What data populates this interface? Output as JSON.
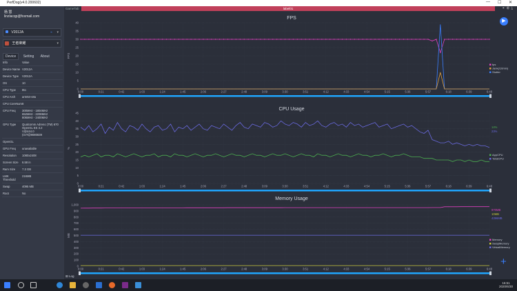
{
  "window": {
    "title": "PerfDog(v4.0.200602)"
  },
  "user": {
    "name": "杨 慧",
    "email": "linzlacqp@foxmail.com"
  },
  "device": {
    "selected": "V2012A"
  },
  "app": {
    "selected": "王者荣耀"
  },
  "sidebar_tabs": [
    {
      "label": "Device"
    },
    {
      "label": "Setting"
    },
    {
      "label": "About"
    }
  ],
  "info_table": {
    "headers": [
      "Info",
      "Value"
    ],
    "rows": [
      {
        "k": "Device Name",
        "v": "V2012A"
      },
      {
        "k": "Device Type",
        "v": "V2012A"
      },
      {
        "k": "OS",
        "v": "10"
      },
      {
        "k": "CPU Type",
        "v": "8to"
      },
      {
        "k": "CPU Arch",
        "v": "arm64-v8a"
      },
      {
        "k": "CPU CoreNum",
        "v": "8"
      },
      {
        "k": "CPU Freq",
        "v": "300MHz - 1804MHz\n652MHz - 2208MHz\n806MHz - 2400MHz"
      },
      {
        "k": "GPU Type",
        "v": "Qualcomm Adreno (TM) 670\nOpenGL ES 3.2\nV@444.0\n(GIT@9080839"
      },
      {
        "k": "OpenGL",
        "v": ""
      },
      {
        "k": "GPU Freq",
        "v": "unavailable"
      },
      {
        "k": "Resolution",
        "v": "1080x2408"
      },
      {
        "k": "Screen Size",
        "v": "6.58 in"
      },
      {
        "k": "Ram Size",
        "v": "7.3 GB"
      },
      {
        "k": "LMK Threshold",
        "v": "216MB"
      },
      {
        "k": "Swap",
        "v": "4095 MB"
      },
      {
        "k": "Root",
        "v": "No"
      }
    ]
  },
  "main_tabs": {
    "game": "GameTab",
    "label": "label01"
  },
  "time_ticks": [
    "0:00",
    "0:21",
    "0:42",
    "1:03",
    "1:24",
    "1:45",
    "2:06",
    "2:27",
    "2:48",
    "3:09",
    "3:30",
    "3:51",
    "4:12",
    "4:33",
    "4:54",
    "5:15",
    "5:36",
    "5:57",
    "6:18",
    "6:39",
    "6:48"
  ],
  "chart_data": [
    {
      "type": "line",
      "title": "FPS",
      "ylabel": "FPS",
      "ylim": [
        0,
        40
      ],
      "yticks": [
        0,
        5,
        10,
        15,
        20,
        25,
        30,
        35,
        40
      ],
      "legend": [
        {
          "name": "fps",
          "color": "#e040c0"
        },
        {
          "name": "Jank(/10min)",
          "color": "#e0a040"
        },
        {
          "name": "Stutter",
          "color": "#3a7fff"
        }
      ],
      "series": [
        {
          "name": "fps",
          "color": "#e040c0",
          "values": [
            30,
            30,
            30,
            30,
            30,
            30,
            30,
            30,
            30,
            30,
            30,
            30,
            30,
            30,
            30,
            30,
            30,
            30,
            30,
            30,
            30,
            30,
            30,
            30,
            30,
            30,
            30,
            30,
            30,
            30,
            30,
            30,
            30,
            30,
            30,
            30,
            30,
            30,
            30,
            30,
            30,
            30,
            30,
            30,
            30,
            30,
            30,
            30,
            30,
            30,
            30,
            30,
            30,
            30,
            30,
            30,
            30,
            30,
            30,
            30,
            30,
            30,
            30,
            30,
            30,
            30,
            30,
            30,
            30,
            30,
            30,
            30,
            30,
            30,
            30,
            30,
            30,
            30,
            30,
            30,
            30,
            30,
            30,
            30,
            30,
            30,
            29,
            30,
            22,
            30,
            30,
            30,
            30,
            30,
            30,
            30,
            30,
            30,
            30,
            30,
            30
          ]
        },
        {
          "name": "Stutter",
          "color": "#3a7fff",
          "values": [
            0,
            0,
            0,
            0,
            0,
            0,
            0,
            0,
            0,
            0,
            0,
            0,
            0,
            0,
            0,
            0,
            0,
            0,
            0,
            0,
            0,
            0,
            0,
            0,
            0,
            0,
            0,
            0,
            0,
            0,
            0,
            0,
            0,
            0,
            0,
            0,
            0,
            0,
            0,
            0,
            0,
            0,
            0,
            0,
            0,
            0,
            0,
            0,
            0,
            0,
            0,
            0,
            0,
            0,
            0,
            0,
            0,
            0,
            0,
            0,
            0,
            0,
            0,
            0,
            0,
            0,
            0,
            0,
            0,
            0,
            0,
            0,
            0,
            0,
            0,
            0,
            0,
            0,
            0,
            0,
            0,
            0,
            0,
            0,
            0,
            0,
            0,
            0,
            39,
            0,
            0,
            0,
            0,
            0,
            0,
            0,
            0,
            0,
            0,
            0,
            0
          ]
        },
        {
          "name": "Jank(/10min)",
          "color": "#e0a040",
          "values": [
            0,
            0,
            0,
            0,
            0,
            0,
            0,
            0,
            0,
            0,
            0,
            0,
            0,
            0,
            0,
            0,
            0,
            0,
            0,
            0,
            0,
            0,
            0,
            0,
            0,
            0,
            0,
            0,
            0,
            0,
            0,
            0,
            0,
            0,
            0,
            0,
            0,
            0,
            0,
            0,
            0,
            0,
            0,
            0,
            0,
            0,
            0,
            0,
            0,
            0,
            0,
            0,
            0,
            0,
            0,
            0,
            0,
            0,
            0,
            0,
            0,
            0,
            0,
            0,
            0,
            0,
            0,
            0,
            0,
            0,
            0,
            0,
            0,
            0,
            0,
            0,
            0,
            0,
            0,
            0,
            0,
            0,
            0,
            0,
            0,
            0,
            0,
            0,
            10,
            0,
            0,
            0,
            0,
            0,
            0,
            0,
            0,
            0,
            0,
            0,
            0
          ]
        }
      ]
    },
    {
      "type": "line",
      "title": "CPU Usage",
      "ylabel": "%",
      "ylim": [
        0,
        45
      ],
      "yticks": [
        0,
        5,
        10,
        15,
        20,
        25,
        30,
        35,
        40,
        45
      ],
      "legend": [
        {
          "name": "AppCPU",
          "color": "#4caf50"
        },
        {
          "name": "TotalCPU",
          "color": "#6a6ae0"
        }
      ],
      "current": [
        {
          "value": "14%",
          "color": "#4caf50"
        },
        {
          "value": "23%",
          "color": "#6a6ae0"
        }
      ],
      "series": [
        {
          "name": "TotalCPU",
          "color": "#6a6ae0",
          "values": [
            36,
            34,
            37,
            33,
            35,
            38,
            32,
            36,
            34,
            39,
            35,
            33,
            37,
            36,
            34,
            38,
            35,
            33,
            36,
            37,
            34,
            35,
            38,
            33,
            36,
            35,
            37,
            34,
            36,
            38,
            35,
            34,
            37,
            36,
            35,
            38,
            36,
            34,
            37,
            39,
            36,
            35,
            38,
            37,
            36,
            39,
            38,
            36,
            37,
            40,
            38,
            37,
            39,
            38,
            36,
            39,
            37,
            38,
            40,
            37,
            36,
            38,
            39,
            37,
            38,
            36,
            39,
            37,
            38,
            36,
            37,
            38,
            39,
            36,
            37,
            38,
            35,
            36,
            37,
            38,
            36,
            37,
            35,
            33,
            32,
            34,
            28,
            27,
            26,
            26,
            27,
            25,
            26,
            25,
            24,
            25,
            24,
            25,
            24,
            24,
            23
          ]
        },
        {
          "name": "AppCPU",
          "color": "#4caf50",
          "values": [
            17,
            18,
            17,
            18,
            19,
            17,
            18,
            18,
            17,
            19,
            18,
            17,
            18,
            19,
            18,
            17,
            18,
            18,
            19,
            17,
            18,
            18,
            17,
            19,
            18,
            18,
            17,
            18,
            19,
            18,
            17,
            18,
            18,
            19,
            18,
            17,
            18,
            19,
            18,
            18,
            17,
            18,
            19,
            18,
            18,
            17,
            18,
            19,
            18,
            18,
            19,
            18,
            17,
            18,
            19,
            18,
            18,
            17,
            19,
            18,
            18,
            17,
            18,
            19,
            18,
            18,
            17,
            18,
            19,
            18,
            18,
            17,
            18,
            18,
            19,
            18,
            17,
            18,
            18,
            19,
            18,
            17,
            17,
            17,
            16,
            16,
            16,
            15,
            15,
            15,
            15,
            14,
            15,
            15,
            14,
            15,
            14,
            14,
            15,
            14,
            14
          ]
        }
      ]
    },
    {
      "type": "line",
      "title": "Memory Usage",
      "ylabel": "MB",
      "ylim": [
        0,
        1000
      ],
      "yticks": [
        0,
        100,
        200,
        300,
        400,
        500,
        600,
        700,
        800,
        900,
        1000
      ],
      "legend": [
        {
          "name": "Memory",
          "color": "#e040c0"
        },
        {
          "name": "SwapMemory",
          "color": "#c6c63a"
        },
        {
          "name": "VirtualMemory",
          "color": "#6a6ae0"
        }
      ],
      "current": [
        {
          "value": "970MB",
          "color": "#e040c0"
        },
        {
          "value": "10MB",
          "color": "#c6c63a"
        },
        {
          "value": "4396MB",
          "color": "#6a6ae0"
        }
      ],
      "series": [
        {
          "name": "Memory",
          "color": "#e040c0",
          "values": [
            945,
            946,
            946,
            947,
            947,
            947,
            948,
            948,
            948,
            949,
            949,
            949,
            950,
            950,
            950,
            950,
            950,
            950,
            950,
            951,
            951,
            951,
            951,
            951,
            951,
            951,
            952,
            952,
            952,
            952,
            952,
            952,
            952,
            952,
            952,
            952,
            953,
            953,
            953,
            953,
            953,
            953,
            953,
            953,
            953,
            953,
            953,
            953,
            953,
            953,
            954,
            954,
            954,
            954,
            954,
            954,
            954,
            954,
            954,
            954,
            954,
            954,
            954,
            954,
            954,
            954,
            954,
            954,
            954,
            954,
            954,
            954,
            954,
            954,
            954,
            954,
            954,
            954,
            954,
            954,
            954,
            954,
            954,
            954,
            954,
            954,
            955,
            955,
            955,
            968,
            969,
            969,
            969,
            970,
            970,
            970,
            970,
            970,
            970,
            970,
            970
          ]
        },
        {
          "name": "VirtualMemory",
          "color": "#6a6ae0",
          "values": [
            505,
            505,
            505,
            505,
            505,
            505,
            505,
            505,
            505,
            505,
            505,
            505,
            505,
            505,
            505,
            505,
            505,
            505,
            505,
            505,
            505,
            505,
            505,
            505,
            505,
            505,
            505,
            505,
            505,
            505,
            505,
            505,
            505,
            505,
            505,
            505,
            505,
            505,
            505,
            505,
            505,
            505,
            505,
            505,
            505,
            505,
            505,
            505,
            505,
            505,
            505,
            505,
            505,
            505,
            505,
            505,
            505,
            505,
            505,
            505,
            505,
            505,
            505,
            505,
            505,
            505,
            505,
            505,
            505,
            505,
            505,
            505,
            505,
            505,
            505,
            505,
            505,
            505,
            505,
            505,
            505,
            505,
            505,
            505,
            505,
            505,
            505,
            505,
            505,
            505,
            505,
            505,
            505,
            505,
            505,
            505,
            505,
            505,
            505,
            505,
            505
          ]
        },
        {
          "name": "SwapMemory",
          "color": "#c6c63a",
          "values": [
            10,
            10,
            10,
            10,
            10,
            10,
            10,
            10,
            10,
            10,
            10,
            10,
            10,
            10,
            10,
            10,
            10,
            10,
            10,
            10,
            10,
            10,
            10,
            10,
            10,
            10,
            10,
            10,
            10,
            10,
            10,
            10,
            10,
            10,
            10,
            10,
            10,
            10,
            10,
            10,
            10,
            10,
            10,
            10,
            10,
            10,
            10,
            10,
            10,
            10,
            10,
            10,
            10,
            10,
            10,
            10,
            10,
            10,
            10,
            10,
            10,
            10,
            10,
            10,
            10,
            10,
            10,
            10,
            10,
            10,
            10,
            10,
            10,
            10,
            10,
            10,
            10,
            10,
            10,
            10,
            10,
            10,
            10,
            10,
            10,
            10,
            10,
            10,
            10,
            10,
            10,
            10,
            10,
            10,
            10,
            10,
            10,
            10,
            10,
            10,
            10
          ]
        }
      ]
    }
  ],
  "bottom": {
    "log": "Log"
  },
  "taskbar": {
    "time": "16:51",
    "date": "2020/6/30"
  }
}
